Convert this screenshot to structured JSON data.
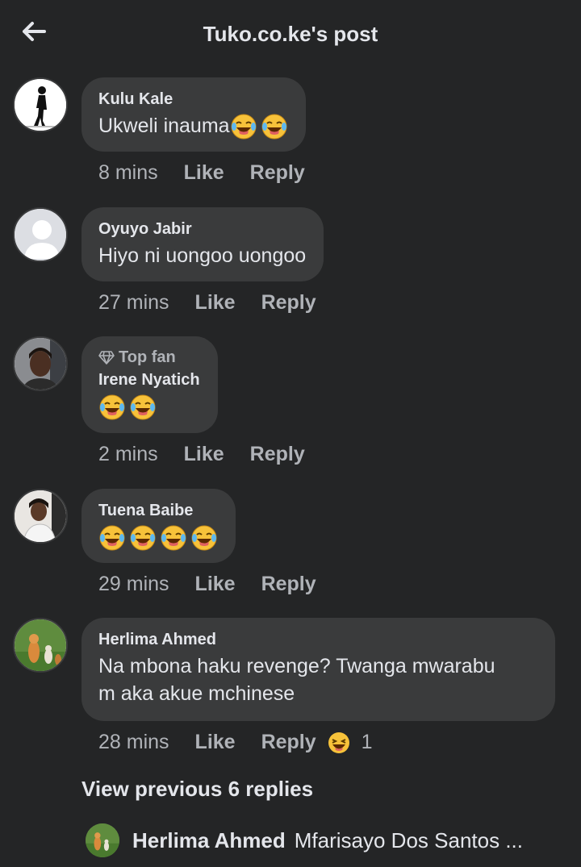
{
  "header": {
    "title": "Tuko.co.ke's post",
    "back_icon": "arrow-left-icon"
  },
  "comments": [
    {
      "name": "Kulu Kale",
      "text": "Ukweli inauma",
      "emojis": [
        "laughing-tears",
        "laughing-tears"
      ],
      "time": "8 mins",
      "like": "Like",
      "reply": "Reply"
    },
    {
      "name": "Oyuyo Jabir",
      "text": "Hiyo ni uongoo uongoo",
      "time": "27 mins",
      "like": "Like",
      "reply": "Reply"
    },
    {
      "badge": "Top fan",
      "name": "Irene Nyatich",
      "emojis": [
        "laughing-tears",
        "laughing-tears"
      ],
      "time": "2 mins",
      "like": "Like",
      "reply": "Reply"
    },
    {
      "name": "Tuena Baibe",
      "emojis": [
        "laughing-tears",
        "laughing-tears",
        "laughing-tears",
        "laughing-tears"
      ],
      "time": "29 mins",
      "like": "Like",
      "reply": "Reply"
    },
    {
      "name": "Herlima Ahmed",
      "text_line1": "Na mbona haku revenge? Twanga mwarabu",
      "text_line2": "m aka akue mchinese",
      "time": "28 mins",
      "like": "Like",
      "reply": "Reply",
      "reaction": "haha",
      "reaction_count": "1"
    }
  ],
  "view_previous": "View previous 6 replies",
  "reply_preview": {
    "name": "Herlima Ahmed",
    "text": "Mfarisayo Dos Santos ..."
  },
  "colors": {
    "background": "#242526",
    "bubble": "#3a3b3c",
    "text": "#e4e6eb",
    "secondary": "#b0b3b8",
    "emoji": "#f7c23a"
  }
}
